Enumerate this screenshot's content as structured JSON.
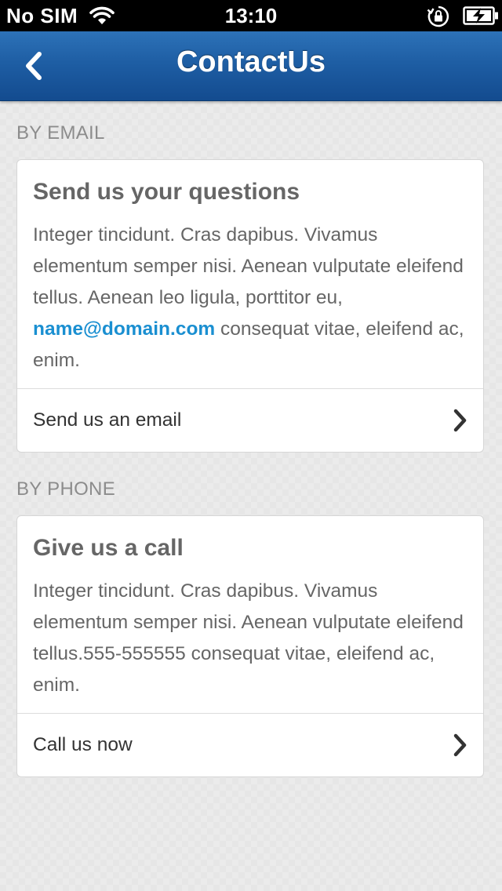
{
  "status_bar": {
    "carrier": "No SIM",
    "time": "13:10"
  },
  "nav": {
    "title": "ContactUs"
  },
  "sections": {
    "email": {
      "header": "BY EMAIL",
      "card_title": "Send us your questions",
      "body_before_link": "Integer tincidunt. Cras dapibus. Vivamus elementum semper nisi. Aenean vulputate eleifend tellus. Aenean leo ligula, porttitor eu, ",
      "link": "name@domain.com",
      "body_after_link": " consequat vitae, eleifend ac, enim.",
      "action_label": "Send us an email"
    },
    "phone": {
      "header": "BY PHONE",
      "card_title": "Give us a call",
      "body": "Integer tincidunt. Cras dapibus. Vivamus elementum semper nisi. Aenean vulputate eleifend tellus.555-555555 consequat vitae, eleifend ac, enim.",
      "action_label": "Call us now"
    }
  },
  "icons": {
    "back": "chevron-left-icon",
    "row_action": "chevron-right-icon",
    "wifi": "wifi-icon",
    "orientation_lock": "orientation-lock-icon",
    "battery": "battery-charging-icon"
  },
  "colors": {
    "nav_bar": "#1e5ea4",
    "link": "#1a8fd1",
    "section_header": "#8c8c8c",
    "card_text": "#666666"
  }
}
